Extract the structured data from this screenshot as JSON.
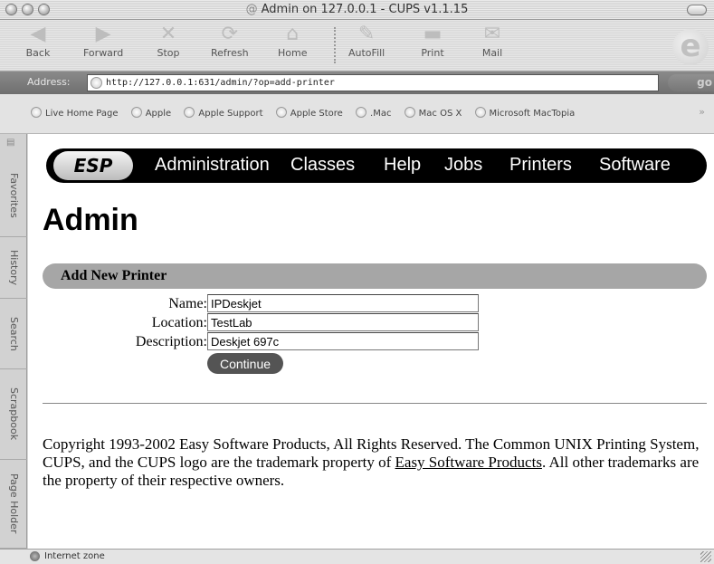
{
  "window": {
    "title": "Admin on 127.0.0.1 - CUPS v1.1.15"
  },
  "toolbar": {
    "buttons": [
      {
        "label": "Back",
        "icon": "back-arrow-icon"
      },
      {
        "label": "Forward",
        "icon": "forward-arrow-icon"
      },
      {
        "label": "Stop",
        "icon": "stop-x-icon"
      },
      {
        "label": "Refresh",
        "icon": "refresh-icon"
      },
      {
        "label": "Home",
        "icon": "home-icon"
      },
      {
        "label": "AutoFill",
        "icon": "autofill-icon"
      },
      {
        "label": "Print",
        "icon": "printer-icon"
      },
      {
        "label": "Mail",
        "icon": "mail-icon"
      }
    ]
  },
  "address": {
    "label": "Address:",
    "url": "http://127.0.0.1:631/admin/?op=add-printer",
    "go_label": "go"
  },
  "favorites": {
    "items": [
      "Live Home Page",
      "Apple",
      "Apple Support",
      "Apple Store",
      ".Mac",
      "Mac OS X",
      "Microsoft MacTopia"
    ],
    "more": "»"
  },
  "sidebar": {
    "tabs": [
      "Favorites",
      "History",
      "Search",
      "Scrapbook",
      "Page Holder"
    ]
  },
  "page": {
    "nav": {
      "brand": "ESP",
      "items": [
        "Administration",
        "Classes",
        "Help",
        "Jobs",
        "Printers",
        "Software"
      ]
    },
    "title": "Admin",
    "section_title": "Add New Printer",
    "form": {
      "name_label": "Name:",
      "name_value": "IPDeskjet",
      "location_label": "Location:",
      "location_value": "TestLab",
      "description_label": "Description:",
      "description_value": "Deskjet 697c",
      "continue_label": "Continue"
    },
    "footer": {
      "text_before": "Copyright 1993-2002 Easy Software Products, All Rights Reserved. The Common UNIX Printing System, CUPS, and the CUPS logo are the trademark property of ",
      "link_text": "Easy Software Products",
      "text_after": ". All other trademarks are the property of their respective owners."
    }
  },
  "status": {
    "text": "Internet zone"
  },
  "colors": {
    "nav_bar": "#000000",
    "section_bar": "#a6a6a6",
    "continue_button": "#545454"
  }
}
